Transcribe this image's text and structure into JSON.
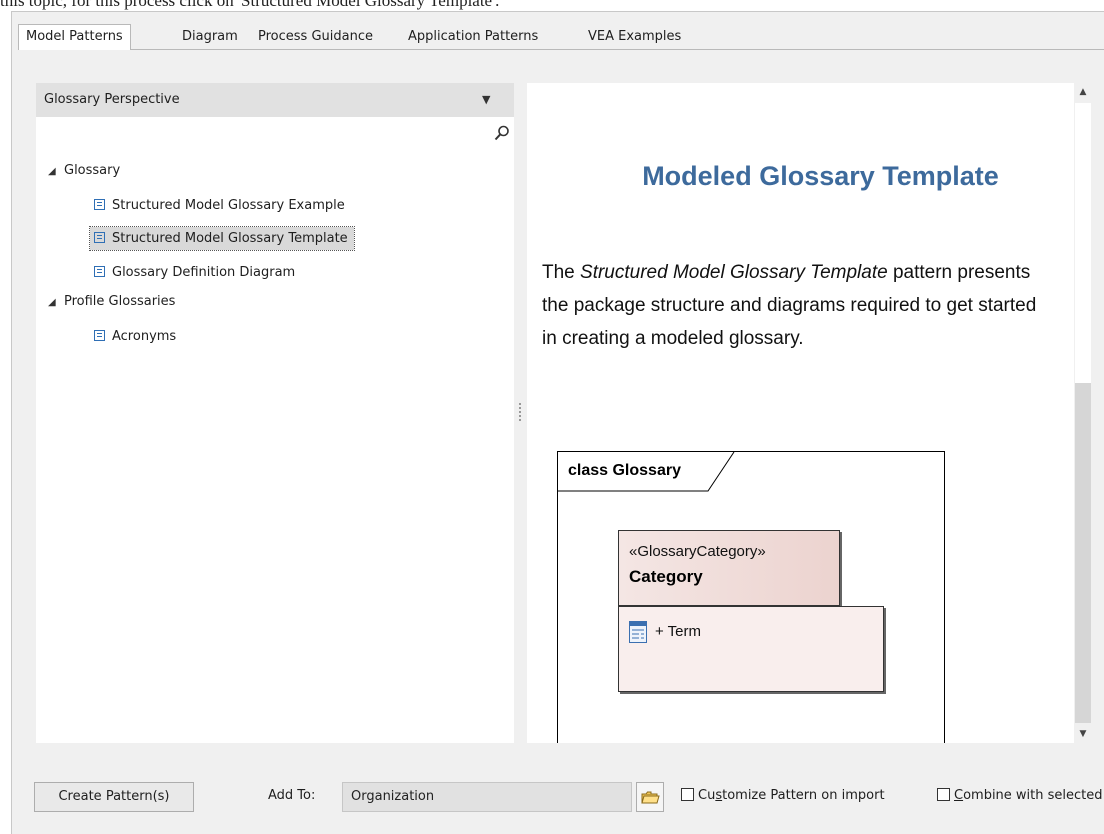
{
  "top_caption": "this topic, for this process click on 'Structured Model Glossary Template'.",
  "tabs": [
    "Model Patterns",
    "Diagram",
    "Process Guidance",
    "Application Patterns",
    "VEA Examples"
  ],
  "perspective": {
    "label": "Glossary Perspective"
  },
  "tree": {
    "glossary": "Glossary",
    "structured_example": "Structured Model Glossary Example",
    "structured_template": "Structured Model Glossary Template",
    "definition_diagram": "Glossary Definition Diagram",
    "profile_glossaries": "Profile Glossaries",
    "acronyms": "Acronyms"
  },
  "help": {
    "title": "Modeled Glossary Template",
    "para_before": "The ",
    "para_italic": "Structured Model Glossary Template",
    "para_after": " pattern presents the package structure and diagrams required to get started in creating a modeled glossary."
  },
  "diagram": {
    "frame_label": "class Glossary",
    "stereotype": "«GlossaryCategory»",
    "class_name": "Category",
    "attribute": "+ Term"
  },
  "bottom": {
    "create_button": "Create Pattern(s)",
    "add_to_label": "Add To:",
    "add_to_value": "Organization",
    "customize_pre": "Cu",
    "customize_u": "s",
    "customize_post": "tomize Pattern on import",
    "combine_u": "C",
    "combine_post": "ombine with selected"
  },
  "colors": {
    "title_blue": "#3d6a9c",
    "class_fill": "#ecd3cf",
    "selection": "#d9d9d9"
  }
}
